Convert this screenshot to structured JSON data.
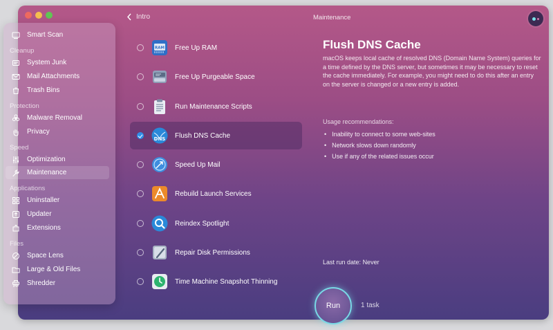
{
  "window": {
    "back_label": "Intro",
    "title": "Maintenance"
  },
  "sidebar": {
    "smart_scan": "Smart Scan",
    "sections": {
      "cleanup": "Cleanup",
      "protection": "Protection",
      "speed": "Speed",
      "applications": "Applications",
      "files": "Files"
    },
    "items": {
      "system_junk": "System Junk",
      "mail_attachments": "Mail Attachments",
      "trash_bins": "Trash Bins",
      "malware_removal": "Malware Removal",
      "privacy": "Privacy",
      "optimization": "Optimization",
      "maintenance": "Maintenance",
      "uninstaller": "Uninstaller",
      "updater": "Updater",
      "extensions": "Extensions",
      "space_lens": "Space Lens",
      "large_old_files": "Large & Old Files",
      "shredder": "Shredder"
    },
    "active": "Maintenance"
  },
  "tasks": [
    {
      "label": "Free Up RAM",
      "checked": false,
      "icon": "ram-chip-icon"
    },
    {
      "label": "Free Up Purgeable Space",
      "checked": false,
      "icon": "drive-icon"
    },
    {
      "label": "Run Maintenance Scripts",
      "checked": false,
      "icon": "clipboard-icon"
    },
    {
      "label": "Flush DNS Cache",
      "checked": true,
      "icon": "dns-icon",
      "icon_text": "DNS"
    },
    {
      "label": "Speed Up Mail",
      "checked": false,
      "icon": "mail-stamp-icon"
    },
    {
      "label": "Rebuild Launch Services",
      "checked": false,
      "icon": "launch-services-icon"
    },
    {
      "label": "Reindex Spotlight",
      "checked": false,
      "icon": "spotlight-icon"
    },
    {
      "label": "Repair Disk Permissions",
      "checked": false,
      "icon": "disk-permissions-icon"
    },
    {
      "label": "Time Machine Snapshot Thinning",
      "checked": false,
      "icon": "time-machine-icon"
    }
  ],
  "detail": {
    "title": "Flush DNS Cache",
    "description": "macOS keeps local cache of resolved DNS (Domain Name System) queries for a time defined by the DNS server, but sometimes it may be necessary to reset the cache immediately. For example, you might need to do this after an entry on the server is changed or a new entry is added.",
    "usage_title": "Usage recommendations:",
    "usage_items": [
      "Inability to connect to some web-sites",
      "Network slows down randomly",
      "Use if any of the related issues occur"
    ],
    "last_run_label": "Last run date:",
    "last_run_value": "Never"
  },
  "footer": {
    "run_label": "Run",
    "task_count": "1 task"
  },
  "colors": {
    "accent_ring": "#79d9e6",
    "checkbox_blue": "#2f8fe8"
  }
}
